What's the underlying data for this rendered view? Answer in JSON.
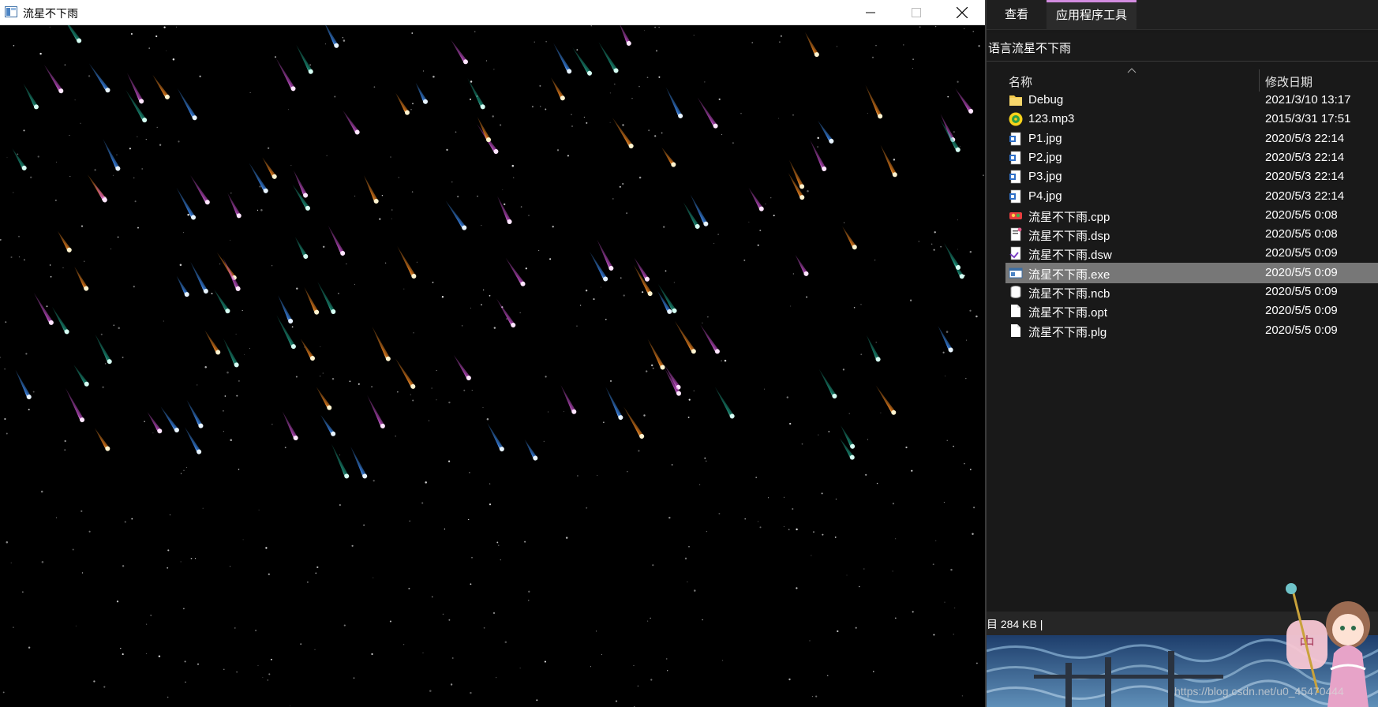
{
  "app": {
    "title": "流星不下雨",
    "minimize": "minimize-icon",
    "maximize": "maximize-icon",
    "close": "close-icon"
  },
  "explorer": {
    "tabs": [
      "查看",
      "应用程序工具"
    ],
    "address": "语言流星不下雨",
    "columns": {
      "name": "名称",
      "date": "修改日期"
    },
    "files": [
      {
        "name": "Debug",
        "date": "2021/3/10 13:17",
        "icon": "folder-icon"
      },
      {
        "name": "123.mp3",
        "date": "2015/3/31 17:51",
        "icon": "audio-icon"
      },
      {
        "name": "P1.jpg",
        "date": "2020/5/3 22:14",
        "icon": "image-icon"
      },
      {
        "name": "P2.jpg",
        "date": "2020/5/3 22:14",
        "icon": "image-icon"
      },
      {
        "name": "P3.jpg",
        "date": "2020/5/3 22:14",
        "icon": "image-icon"
      },
      {
        "name": "P4.jpg",
        "date": "2020/5/3 22:14",
        "icon": "image-icon"
      },
      {
        "name": "流星不下雨.cpp",
        "date": "2020/5/5 0:08",
        "icon": "cpp-icon"
      },
      {
        "name": "流星不下雨.dsp",
        "date": "2020/5/5 0:08",
        "icon": "project-icon"
      },
      {
        "name": "流星不下雨.dsw",
        "date": "2020/5/5 0:09",
        "icon": "workspace-icon"
      },
      {
        "name": "流星不下雨.exe",
        "date": "2020/5/5 0:09",
        "icon": "exe-icon",
        "selected": true
      },
      {
        "name": "流星不下雨.ncb",
        "date": "2020/5/5 0:09",
        "icon": "database-icon"
      },
      {
        "name": "流星不下雨.opt",
        "date": "2020/5/5 0:09",
        "icon": "file-icon"
      },
      {
        "name": "流星不下雨.plg",
        "date": "2020/5/5 0:09",
        "icon": "file-icon"
      }
    ],
    "status": "目  284 KB  |",
    "watermark": "https://blog.csdn.net/u0_45470444",
    "mascot_text": "中"
  },
  "colors": {
    "selection": "#777777",
    "explorer_bg": "#191919",
    "tab_accent": "#d38ce0",
    "meteor_palette": [
      "#ff9a2e",
      "#4aa3ff",
      "#d35bd6",
      "#2fd1b0"
    ]
  }
}
